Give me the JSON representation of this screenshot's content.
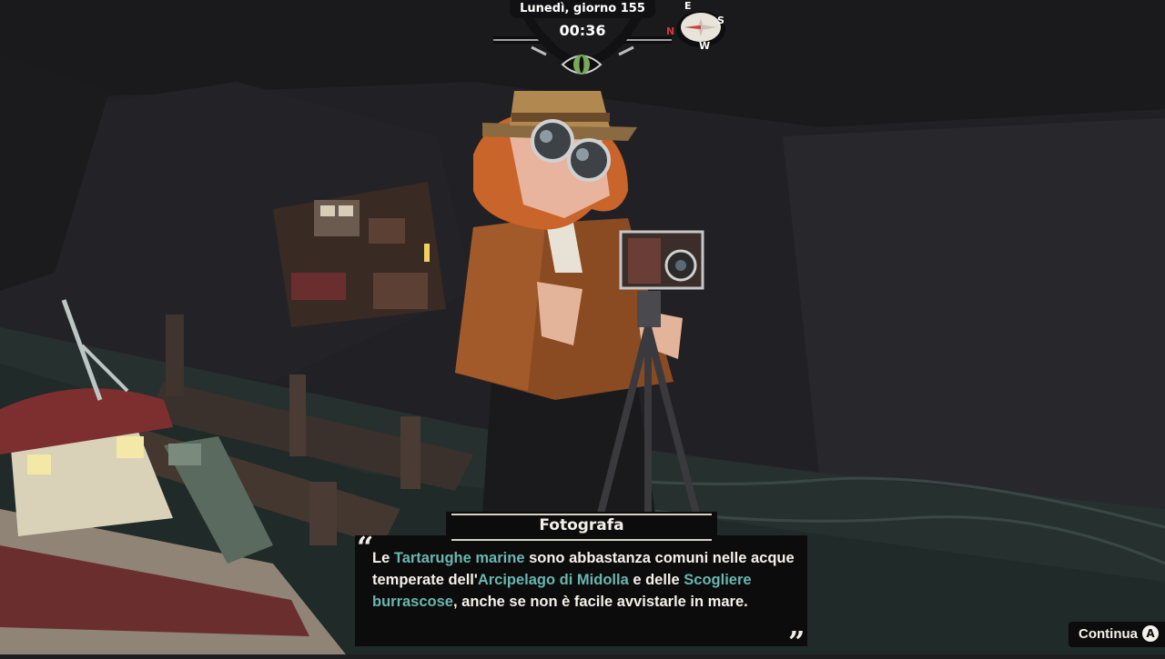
{
  "hud": {
    "day": "Lunedì, giorno 155",
    "time": "00:36"
  },
  "compass": {
    "north": "N",
    "east": "E",
    "south": "S",
    "west": "W"
  },
  "dialogue": {
    "speaker": "Fotografa",
    "segments": [
      {
        "text": "Le ",
        "highlight": false
      },
      {
        "text": "Tartarughe marine",
        "highlight": true
      },
      {
        "text": " sono abbastanza comuni nelle acque temperate dell'",
        "highlight": false
      },
      {
        "text": "Arcipelago di Midolla",
        "highlight": true
      },
      {
        "text": " e delle ",
        "highlight": false
      },
      {
        "text": "Scogliere burrascose",
        "highlight": true
      },
      {
        "text": ", anche se non è facile avvistarle in mare.",
        "highlight": false
      }
    ],
    "open_quote": "“",
    "close_quote": "”"
  },
  "prompt": {
    "label": "Continua",
    "button": "A"
  },
  "colors": {
    "highlight": "#69b6b0",
    "panel": "#0c0c0d",
    "text": "#f4f1ea"
  }
}
